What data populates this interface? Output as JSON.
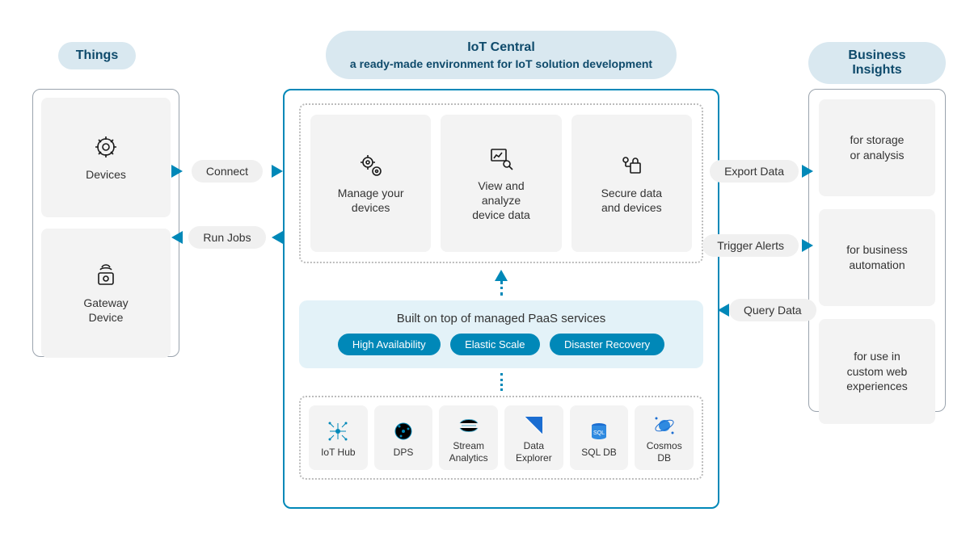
{
  "colors": {
    "accent": "#0088b8",
    "pill_bg": "#d9e8f0",
    "pill_text": "#0e4a6b",
    "card_bg": "#f3f3f3",
    "paas_bg": "#e3f2f8",
    "border": "#9aa3ad"
  },
  "left": {
    "title": "Things",
    "cards": [
      {
        "label": "Devices",
        "icon": "gear-circle-icon"
      },
      {
        "label": "Gateway\nDevice",
        "icon": "gateway-device-icon"
      }
    ]
  },
  "center": {
    "title_line1": "IoT Central",
    "title_line2": "a ready-made environment for IoT solution development",
    "top_cards": [
      {
        "label": "Manage your\ndevices",
        "icon": "gears-icon"
      },
      {
        "label": "View and\nanalyze\ndevice data",
        "icon": "chart-search-icon"
      },
      {
        "label": "Secure data\nand devices",
        "icon": "shield-lock-icon"
      }
    ],
    "paas": {
      "heading": "Built on top of managed PaaS services",
      "pills": [
        "High Availability",
        "Elastic Scale",
        "Disaster Recovery"
      ]
    },
    "services": [
      {
        "label": "IoT Hub",
        "icon": "iot-hub-icon"
      },
      {
        "label": "DPS",
        "icon": "dps-icon"
      },
      {
        "label": "Stream\nAnalytics",
        "icon": "stream-analytics-icon"
      },
      {
        "label": "Data\nExplorer",
        "icon": "data-explorer-icon"
      },
      {
        "label": "SQL DB",
        "icon": "sql-db-icon"
      },
      {
        "label": "Cosmos\nDB",
        "icon": "cosmos-db-icon"
      }
    ]
  },
  "right": {
    "title": "Business Insights",
    "cards": [
      "for storage\nor analysis",
      "for business\nautomation",
      "for use in\ncustom web\nexperiences"
    ]
  },
  "connectors": {
    "left_to_center": "Connect",
    "center_to_left": "Run Jobs",
    "center_to_right_1": "Export Data",
    "center_to_right_2": "Trigger Alerts",
    "center_to_right_3": "Query Data"
  }
}
